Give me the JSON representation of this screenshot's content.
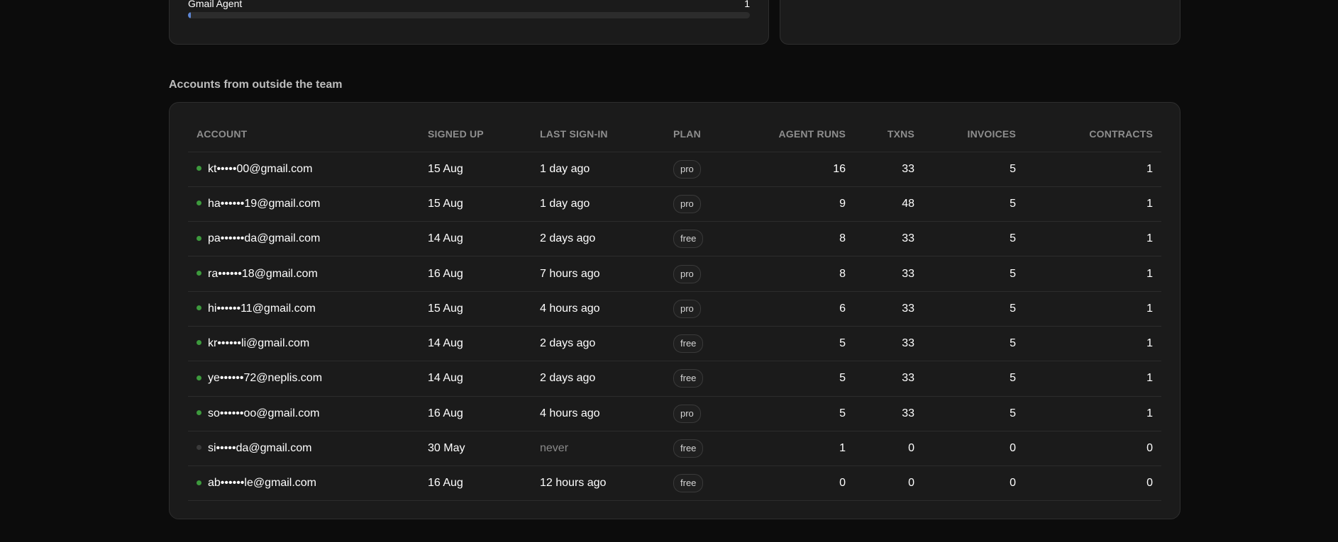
{
  "top_panel": {
    "agent_name": "Gmail Agent",
    "agent_count": "1",
    "progress_fraction": 0.004
  },
  "accounts_section": {
    "title": "Accounts from outside the team",
    "columns": {
      "account": "ACCOUNT",
      "signed_up": "SIGNED UP",
      "last_sign_in": "LAST SIGN-IN",
      "plan": "PLAN",
      "agent_runs": "AGENT RUNS",
      "txns": "TXNS",
      "invoices": "INVOICES",
      "contracts": "CONTRACTS"
    },
    "rows": [
      {
        "active": true,
        "account": "kt•••••00@gmail.com",
        "signed_up": "15 Aug",
        "last_sign_in": "1 day ago",
        "plan": "pro",
        "agent_runs": "16",
        "txns": "33",
        "invoices": "5",
        "contracts": "1"
      },
      {
        "active": true,
        "account": "ha••••••19@gmail.com",
        "signed_up": "15 Aug",
        "last_sign_in": "1 day ago",
        "plan": "pro",
        "agent_runs": "9",
        "txns": "48",
        "invoices": "5",
        "contracts": "1"
      },
      {
        "active": true,
        "account": "pa••••••da@gmail.com",
        "signed_up": "14 Aug",
        "last_sign_in": "2 days ago",
        "plan": "free",
        "agent_runs": "8",
        "txns": "33",
        "invoices": "5",
        "contracts": "1"
      },
      {
        "active": true,
        "account": "ra••••••18@gmail.com",
        "signed_up": "16 Aug",
        "last_sign_in": "7 hours ago",
        "plan": "pro",
        "agent_runs": "8",
        "txns": "33",
        "invoices": "5",
        "contracts": "1"
      },
      {
        "active": true,
        "account": "hi••••••11@gmail.com",
        "signed_up": "15 Aug",
        "last_sign_in": "4 hours ago",
        "plan": "pro",
        "agent_runs": "6",
        "txns": "33",
        "invoices": "5",
        "contracts": "1"
      },
      {
        "active": true,
        "account": "kr••••••li@gmail.com",
        "signed_up": "14 Aug",
        "last_sign_in": "2 days ago",
        "plan": "free",
        "agent_runs": "5",
        "txns": "33",
        "invoices": "5",
        "contracts": "1"
      },
      {
        "active": true,
        "account": "ye••••••72@neplis.com",
        "signed_up": "14 Aug",
        "last_sign_in": "2 days ago",
        "plan": "free",
        "agent_runs": "5",
        "txns": "33",
        "invoices": "5",
        "contracts": "1"
      },
      {
        "active": true,
        "account": "so••••••oo@gmail.com",
        "signed_up": "16 Aug",
        "last_sign_in": "4 hours ago",
        "plan": "pro",
        "agent_runs": "5",
        "txns": "33",
        "invoices": "5",
        "contracts": "1"
      },
      {
        "active": false,
        "account": "si•••••da@gmail.com",
        "signed_up": "30 May",
        "last_sign_in": "never",
        "plan": "free",
        "agent_runs": "1",
        "txns": "0",
        "invoices": "0",
        "contracts": "0"
      },
      {
        "active": true,
        "account": "ab••••••le@gmail.com",
        "signed_up": "16 Aug",
        "last_sign_in": "12 hours ago",
        "plan": "free",
        "agent_runs": "0",
        "txns": "0",
        "invoices": "0",
        "contracts": "0"
      }
    ]
  },
  "colors": {
    "background": "#0c0c0c",
    "card": "#1b1b1b",
    "active_dot": "#3d9a3d",
    "inactive_dot": "#3a3a3a",
    "progress": "#5d86d4"
  }
}
